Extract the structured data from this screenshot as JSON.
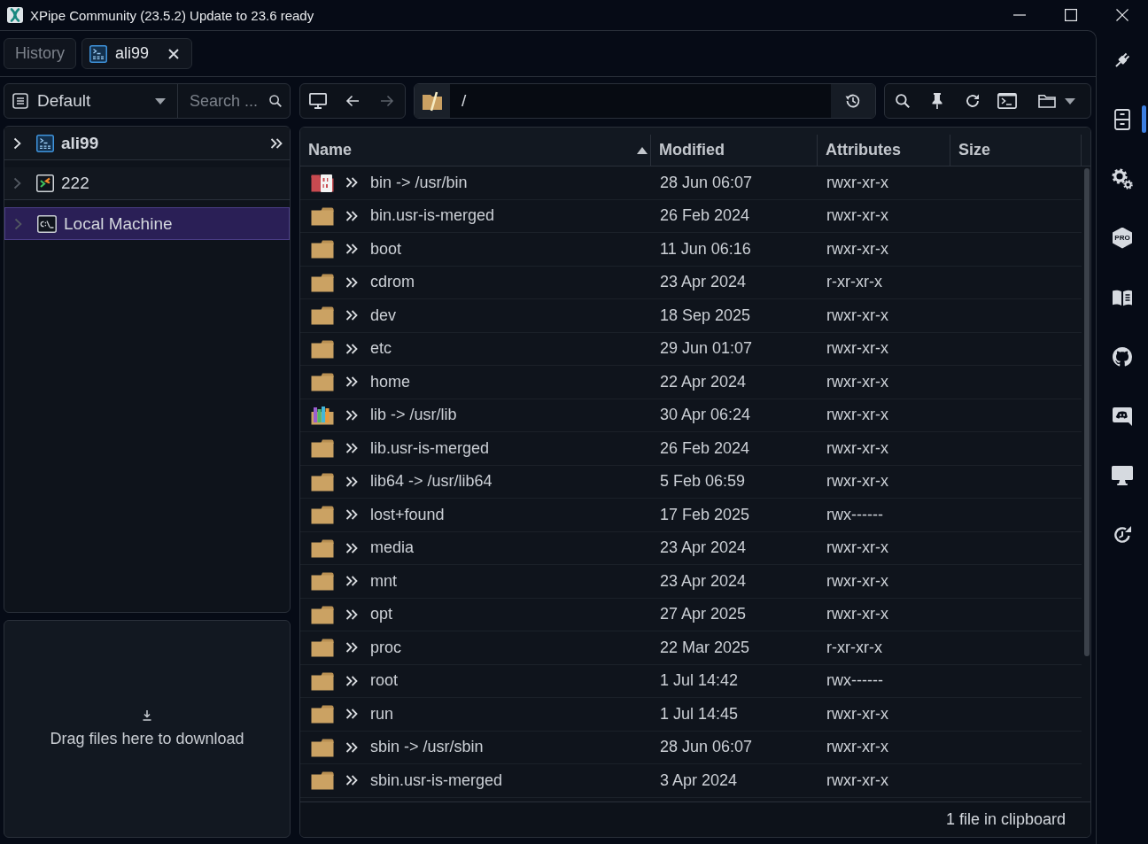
{
  "window": {
    "title": "XPipe Community (23.5.2) Update to 23.6 ready"
  },
  "tabs": [
    {
      "label": "History",
      "kind": "plain",
      "selected": false,
      "closable": false
    },
    {
      "label": "ali99",
      "kind": "ssh",
      "selected": true,
      "closable": true
    }
  ],
  "connections": {
    "category": "Default",
    "search": {
      "placeholder": "Search ..."
    },
    "items": [
      {
        "name": "ali99",
        "kind": "ssh",
        "open": true,
        "selected": false
      },
      {
        "name": "222",
        "kind": "remote",
        "open": false,
        "selected": false
      },
      {
        "name": "Local Machine",
        "kind": "local",
        "open": false,
        "selected": true
      }
    ]
  },
  "download_area": {
    "label": "Drag files here to download"
  },
  "browser": {
    "nav_buttons": [
      {
        "kind": "desktop",
        "disabled": false
      },
      {
        "kind": "back",
        "disabled": false
      },
      {
        "kind": "forward",
        "disabled": true
      }
    ],
    "path": "/",
    "columns": [
      {
        "label": "Name",
        "sorted": true
      },
      {
        "label": "Modified",
        "sorted": false
      },
      {
        "label": "Attributes",
        "sorted": false
      },
      {
        "label": "Size",
        "sorted": false
      }
    ],
    "rows": [
      {
        "kind": "binaries",
        "name": "bin -> /usr/bin",
        "modified": "28 Jun 06:07",
        "attributes": "rwxr-xr-x"
      },
      {
        "kind": "folder",
        "name": "bin.usr-is-merged",
        "modified": "26 Feb 2024",
        "attributes": "rwxr-xr-x"
      },
      {
        "kind": "folder",
        "name": "boot",
        "modified": "11 Jun 06:16",
        "attributes": "rwxr-xr-x"
      },
      {
        "kind": "folder",
        "name": "cdrom",
        "modified": "23 Apr 2024",
        "attributes": "r-xr-xr-x"
      },
      {
        "kind": "folder",
        "name": "dev",
        "modified": "18 Sep 2025",
        "attributes": "rwxr-xr-x"
      },
      {
        "kind": "folder",
        "name": "etc",
        "modified": "29 Jun 01:07",
        "attributes": "rwxr-xr-x"
      },
      {
        "kind": "folder",
        "name": "home",
        "modified": "22 Apr 2024",
        "attributes": "rwxr-xr-x"
      },
      {
        "kind": "libraries",
        "name": "lib -> /usr/lib",
        "modified": "30 Apr 06:24",
        "attributes": "rwxr-xr-x"
      },
      {
        "kind": "folder",
        "name": "lib.usr-is-merged",
        "modified": "26 Feb 2024",
        "attributes": "rwxr-xr-x"
      },
      {
        "kind": "folder",
        "name": "lib64 -> /usr/lib64",
        "modified": "5 Feb 06:59",
        "attributes": "rwxr-xr-x"
      },
      {
        "kind": "folder",
        "name": "lost+found",
        "modified": "17 Feb 2025",
        "attributes": "rwx------"
      },
      {
        "kind": "folder",
        "name": "media",
        "modified": "23 Apr 2024",
        "attributes": "rwxr-xr-x"
      },
      {
        "kind": "folder",
        "name": "mnt",
        "modified": "23 Apr 2024",
        "attributes": "rwxr-xr-x"
      },
      {
        "kind": "folder",
        "name": "opt",
        "modified": "27 Apr 2025",
        "attributes": "rwxr-xr-x"
      },
      {
        "kind": "folder",
        "name": "proc",
        "modified": "22 Mar 2025",
        "attributes": "r-xr-xr-x"
      },
      {
        "kind": "folder",
        "name": "root",
        "modified": "1 Jul 14:42",
        "attributes": "rwx------"
      },
      {
        "kind": "folder",
        "name": "run",
        "modified": "1 Jul 14:45",
        "attributes": "rwxr-xr-x"
      },
      {
        "kind": "folder",
        "name": "sbin -> /usr/sbin",
        "modified": "28 Jun 06:07",
        "attributes": "rwxr-xr-x"
      },
      {
        "kind": "folder",
        "name": "sbin.usr-is-merged",
        "modified": "3 Apr 2024",
        "attributes": "rwxr-xr-x"
      }
    ],
    "status": "1 file in clipboard"
  },
  "sidebar": {
    "items": [
      {
        "kind": "connections",
        "selected": false
      },
      {
        "kind": "browser",
        "selected": true
      },
      {
        "kind": "settings",
        "selected": false
      },
      {
        "kind": "pro",
        "label": "PRO",
        "selected": false
      },
      {
        "kind": "docs",
        "selected": false
      },
      {
        "kind": "github",
        "selected": false
      },
      {
        "kind": "discord",
        "selected": false
      },
      {
        "kind": "desktop",
        "selected": false
      },
      {
        "kind": "updates",
        "selected": false
      }
    ]
  }
}
